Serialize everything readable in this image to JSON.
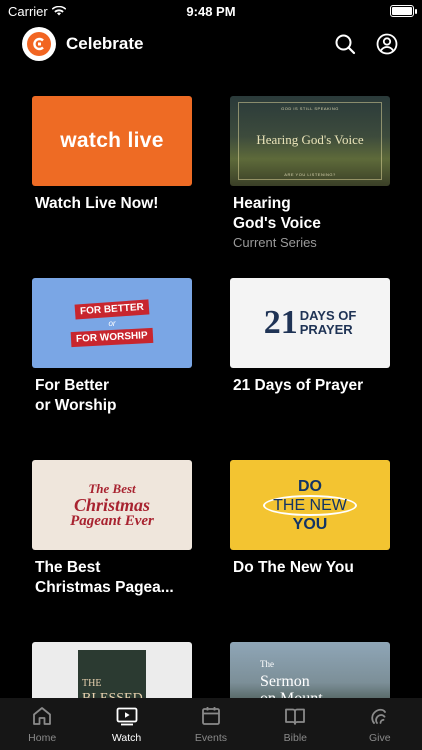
{
  "status_bar": {
    "carrier": "Carrier",
    "time": "9:48 PM"
  },
  "header": {
    "title": "Celebrate",
    "logo_icon": "celebrate-logo",
    "accent_color": "#f26522"
  },
  "cards": [
    {
      "title_line1": "Watch Live Now!",
      "title_line2": "",
      "subtitle": "",
      "thumb_text": "watch live"
    },
    {
      "title_line1": "Hearing",
      "title_line2": "God's Voice",
      "subtitle": "Current Series",
      "thumb_text": "Hearing God's Voice",
      "thumb_top_small": "GOD IS STILL SPEAKING",
      "thumb_bottom_small": "ARE YOU LISTENING?"
    },
    {
      "title_line1": "For Better",
      "title_line2": "or Worship",
      "subtitle": "",
      "thumb_line1": "FOR BETTER",
      "thumb_line2": "or",
      "thumb_line3": "FOR WORSHIP"
    },
    {
      "title_line1": "21 Days of Prayer",
      "title_line2": "",
      "subtitle": "",
      "thumb_num": "21",
      "thumb_w1": "DAYS OF",
      "thumb_w2": "PRAYER"
    },
    {
      "title_line1": "The Best",
      "title_line2": "Christmas Pagea...",
      "subtitle": "",
      "thumb_l1": "The Best",
      "thumb_l2": "Christmas",
      "thumb_l3": "Pageant Ever"
    },
    {
      "title_line1": "Do The New You",
      "title_line2": "",
      "subtitle": "",
      "thumb_d1": "DO",
      "thumb_d2": "THE NEW",
      "thumb_d3": "YOU"
    },
    {
      "title_line1": "",
      "title_line2": "",
      "subtitle": "",
      "thumb_s1": "THE",
      "thumb_s2": "BLESSED"
    },
    {
      "title_line1": "",
      "title_line2": "",
      "subtitle": "",
      "thumb_s1": "The",
      "thumb_s2": "Sermon",
      "thumb_s3": "on Mount"
    }
  ],
  "tabs": [
    {
      "label": "Home",
      "icon": "home-icon",
      "active": false
    },
    {
      "label": "Watch",
      "icon": "play-icon",
      "active": true
    },
    {
      "label": "Events",
      "icon": "calendar-icon",
      "active": false
    },
    {
      "label": "Bible",
      "icon": "book-icon",
      "active": false
    },
    {
      "label": "Give",
      "icon": "give-icon",
      "active": false
    }
  ]
}
